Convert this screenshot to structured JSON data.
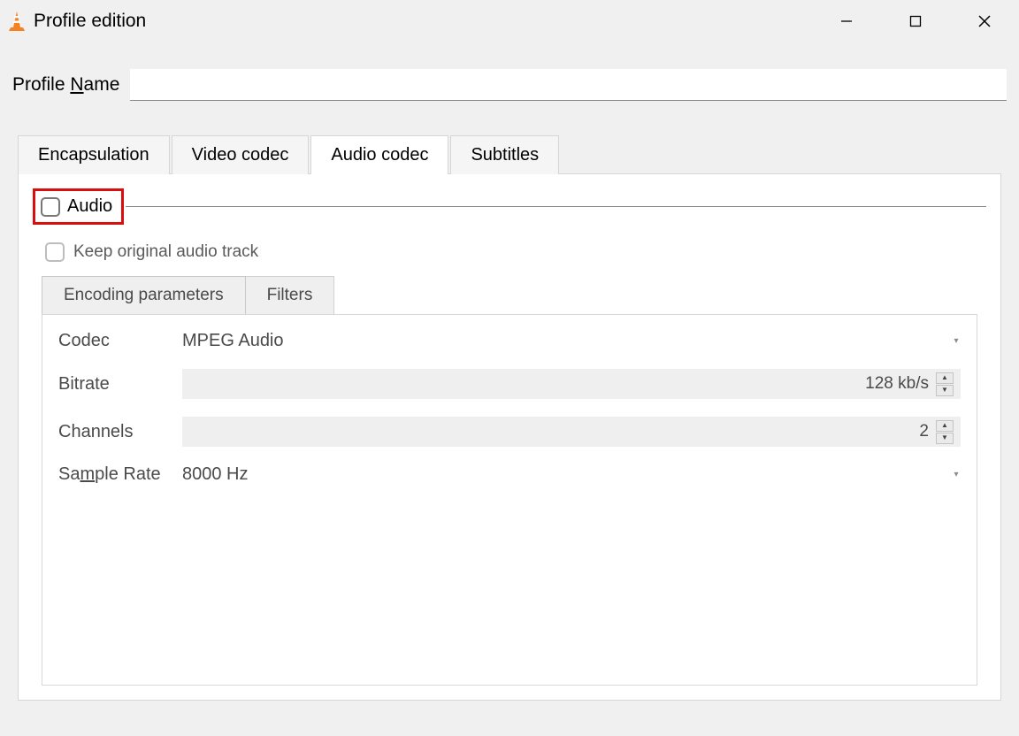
{
  "window": {
    "title": "Profile edition"
  },
  "profile": {
    "label_pre": "Profile ",
    "label_ul": "N",
    "label_post": "ame",
    "value": ""
  },
  "tabs": {
    "encapsulation": "Encapsulation",
    "video_codec": "Video codec",
    "audio_codec": "Audio codec",
    "subtitles": "Subtitles"
  },
  "audio": {
    "header_label": "Audio",
    "keep_original": "Keep original audio track"
  },
  "subtabs": {
    "encoding": "Encoding parameters",
    "filters": "Filters"
  },
  "params": {
    "codec_label": "Codec",
    "codec_value": "MPEG Audio",
    "bitrate_label": "Bitrate",
    "bitrate_value": "128 kb/s",
    "channels_label": "Channels",
    "channels_value": "2",
    "samplerate_pre": "Sa",
    "samplerate_ul": "m",
    "samplerate_post": "ple Rate",
    "samplerate_value": "8000 Hz"
  }
}
